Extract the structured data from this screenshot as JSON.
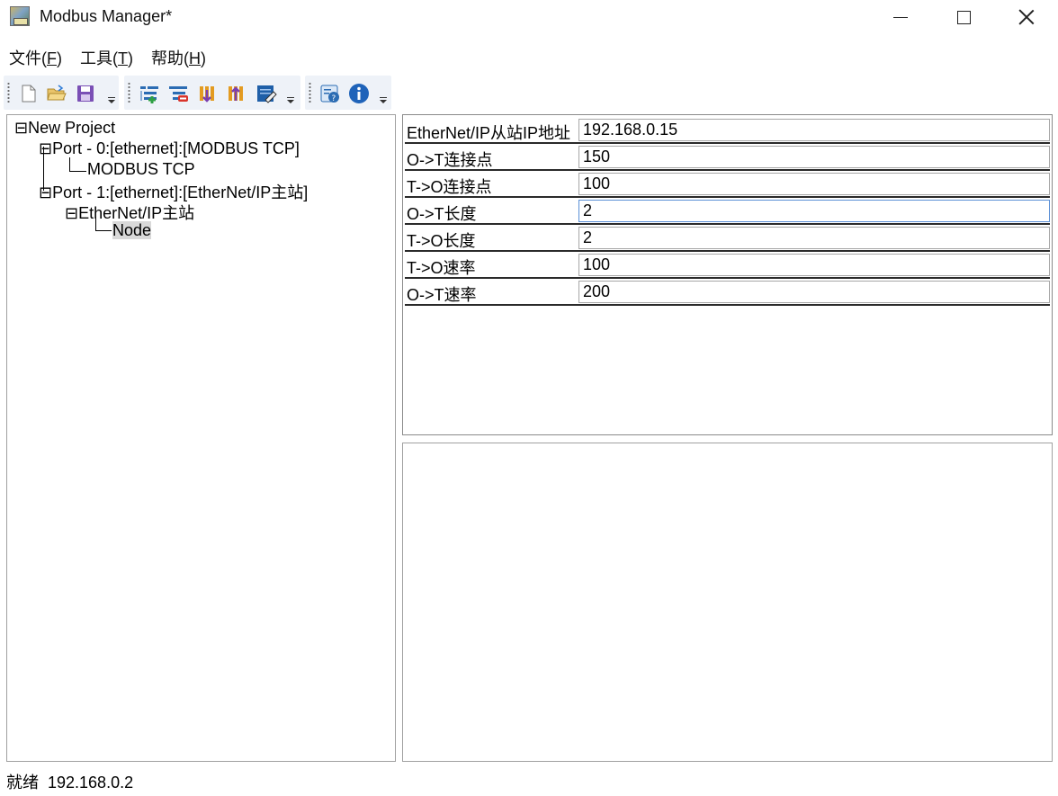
{
  "window": {
    "title": "Modbus Manager*"
  },
  "menu": {
    "file": {
      "text": "文件(",
      "key": "F",
      "end": ")"
    },
    "tools": {
      "text": "工具(",
      "key": "T",
      "end": ")"
    },
    "help": {
      "text": "帮助(",
      "key": "H",
      "end": ")"
    }
  },
  "toolbar": {
    "groups": [
      [
        "new-file-icon",
        "open-folder-icon",
        "save-icon"
      ],
      [
        "add-port-icon",
        "delete-port-icon",
        "download-icon",
        "upload-icon",
        "edit-icon"
      ],
      [
        "help-icon",
        "info-icon"
      ]
    ]
  },
  "tree": {
    "root": "New Project",
    "port0": "Port - 0:[ethernet]:[MODBUS TCP]",
    "port0_child": "MODBUS TCP",
    "port1": "Port - 1:[ethernet]:[EtherNet/IP主站]",
    "port1_child": "EtherNet/IP主站",
    "node": "Node"
  },
  "properties": [
    {
      "label": "EtherNet/IP从站IP地址",
      "value": "192.168.0.15"
    },
    {
      "label": "O->T连接点",
      "value": "150"
    },
    {
      "label": "T->O连接点",
      "value": "100"
    },
    {
      "label": "O->T长度",
      "value": "2"
    },
    {
      "label": "T->O长度",
      "value": "2"
    },
    {
      "label": "T->O速率",
      "value": "100"
    },
    {
      "label": "O->T速率",
      "value": "200"
    }
  ],
  "status": {
    "text": "就绪  192.168.0.2"
  }
}
